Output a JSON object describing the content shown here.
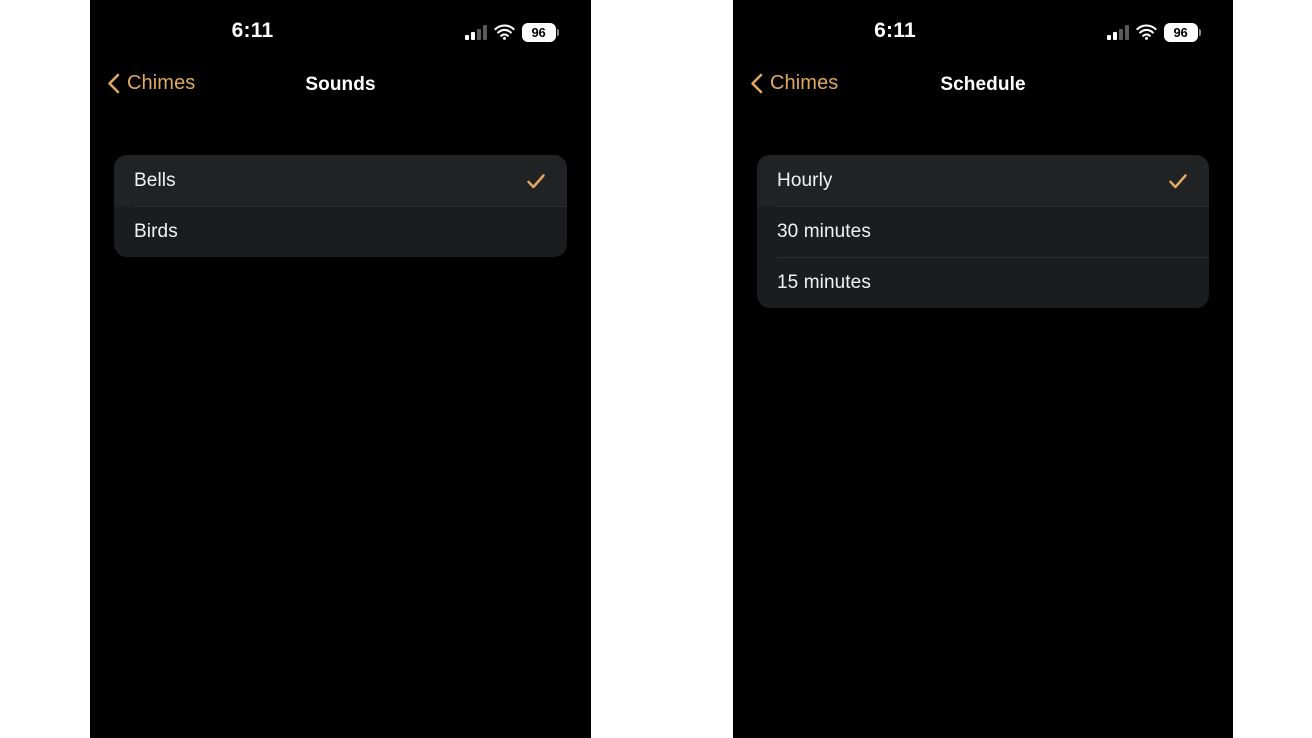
{
  "theme": {
    "page_background": "#ffffff",
    "screen_background": "#000000",
    "card_background": "#1b1c1e",
    "accent": "#e0a860",
    "text_primary": "#f2f2f4",
    "separator": "#2c2d2f"
  },
  "screens": [
    {
      "id": "sounds",
      "status_bar": {
        "time": "6:11",
        "battery_percent": "96",
        "signal_icon": "cellular-signal-icon",
        "wifi_icon": "wifi-icon",
        "battery_icon": "battery-icon"
      },
      "nav": {
        "back_label": "Chimes",
        "back_icon": "chevron-left-icon",
        "title": "Sounds"
      },
      "list": {
        "items": [
          {
            "label": "Bells",
            "selected": true,
            "check_icon": "checkmark-icon"
          },
          {
            "label": "Birds",
            "selected": false,
            "check_icon": ""
          }
        ]
      }
    },
    {
      "id": "schedule",
      "status_bar": {
        "time": "6:11",
        "battery_percent": "96",
        "signal_icon": "cellular-signal-icon",
        "wifi_icon": "wifi-icon",
        "battery_icon": "battery-icon"
      },
      "nav": {
        "back_label": "Chimes",
        "back_icon": "chevron-left-icon",
        "title": "Schedule"
      },
      "list": {
        "items": [
          {
            "label": "Hourly",
            "selected": true,
            "check_icon": "checkmark-icon"
          },
          {
            "label": "30 minutes",
            "selected": false,
            "check_icon": ""
          },
          {
            "label": "15 minutes",
            "selected": false,
            "check_icon": ""
          }
        ]
      }
    }
  ]
}
